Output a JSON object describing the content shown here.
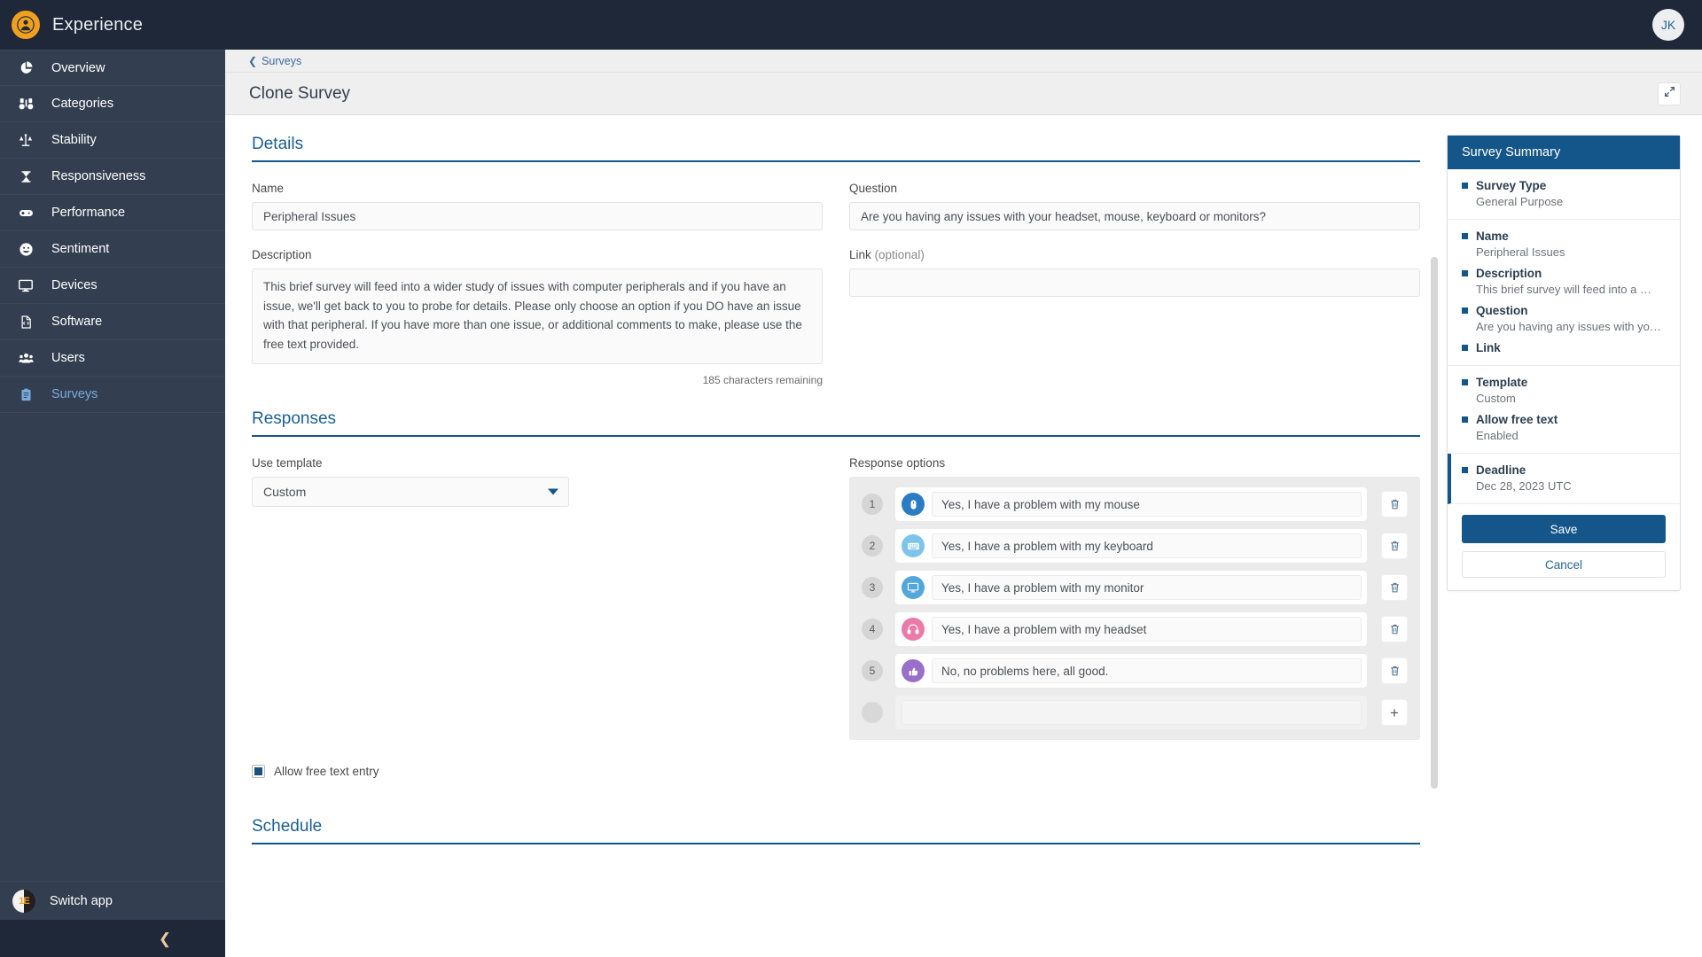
{
  "brand": {
    "title": "Experience"
  },
  "sidebar": {
    "items": [
      {
        "label": "Overview",
        "icon": "pie-chart-icon",
        "active": false
      },
      {
        "label": "Categories",
        "icon": "binoculars-icon",
        "active": false
      },
      {
        "label": "Stability",
        "icon": "scales-icon",
        "active": false
      },
      {
        "label": "Responsiveness",
        "icon": "hourglass-icon",
        "active": false
      },
      {
        "label": "Performance",
        "icon": "gauge-icon",
        "active": false
      },
      {
        "label": "Sentiment",
        "icon": "smiley-icon",
        "active": false
      },
      {
        "label": "Devices",
        "icon": "monitor-icon",
        "active": false
      },
      {
        "label": "Software",
        "icon": "file-code-icon",
        "active": false
      },
      {
        "label": "Users",
        "icon": "users-icon",
        "active": false
      },
      {
        "label": "Surveys",
        "icon": "clipboard-icon",
        "active": true
      }
    ],
    "switch_app": "Switch app",
    "switch_app_logo": "1E",
    "collapse_icon": "chevron-left-icon"
  },
  "topbar": {
    "avatar_initials": "JK"
  },
  "breadcrumb": {
    "label": "Surveys",
    "icon": "chevron-left-icon"
  },
  "page": {
    "title": "Clone Survey",
    "expand_icon": "expand-arrows-icon"
  },
  "details": {
    "section_title": "Details",
    "name_label": "Name",
    "name_value": "Peripheral Issues",
    "name_placeholder": "Name",
    "description_label": "Description",
    "description_value": "This brief survey will feed into a wider study of issues with computer peripherals and if you have an issue, we'll get back to you to probe for details. Please only choose an option if you DO have an issue with that peripheral. If you have more than one issue, or additional comments to make, please use the free text provided.",
    "description_placeholder": "Description",
    "char_count": "185 characters remaining",
    "question_label": "Question",
    "question_value": "Are you having any issues with your headset, mouse, keyboard or monitors?",
    "question_placeholder": "Question",
    "link_label": "Link",
    "link_optional": "(optional)",
    "link_value": "",
    "link_placeholder": ""
  },
  "responses": {
    "section_title": "Responses",
    "template_label": "Use template",
    "template_value": "Custom",
    "template_caret_icon": "chevron-down-icon",
    "options_label": "Response options",
    "options": [
      {
        "num": "1",
        "icon": "mouse-icon",
        "icon_color": "#2b7cc4",
        "text": "Yes, I have a problem with my mouse",
        "action": "trash-icon"
      },
      {
        "num": "2",
        "icon": "keyboard-icon",
        "icon_color": "#7ec4ea",
        "text": "Yes, I have a problem with my keyboard",
        "action": "trash-icon"
      },
      {
        "num": "3",
        "icon": "monitor-icon",
        "icon_color": "#52a6dc",
        "text": "Yes, I have a problem with my monitor",
        "action": "trash-icon"
      },
      {
        "num": "4",
        "icon": "headset-icon",
        "icon_color": "#ea7aa8",
        "text": "Yes, I have a problem with my headset",
        "action": "trash-icon"
      },
      {
        "num": "5",
        "icon": "thumbs-up-icon",
        "icon_color": "#9a6fc9",
        "text": "No, no problems here, all good.",
        "action": "trash-icon"
      }
    ],
    "add_row": {
      "num": "",
      "icon": "",
      "text": "",
      "placeholder": "",
      "action": "plus-icon"
    },
    "free_text_label": "Allow free text entry",
    "free_text_checked": true
  },
  "schedule": {
    "section_title": "Schedule"
  },
  "summary": {
    "title": "Survey Summary",
    "groups": [
      {
        "accent": false,
        "items": [
          {
            "key": "Survey Type",
            "value": "General Purpose"
          }
        ]
      },
      {
        "accent": false,
        "items": [
          {
            "key": "Name",
            "value": "Peripheral Issues"
          },
          {
            "key": "Description",
            "value": "This brief survey will feed into a …"
          },
          {
            "key": "Question",
            "value": "Are you having any issues with yo…"
          },
          {
            "key": "Link",
            "value": ""
          }
        ]
      },
      {
        "accent": false,
        "items": [
          {
            "key": "Template",
            "value": "Custom"
          },
          {
            "key": "Allow free text",
            "value": "Enabled"
          }
        ]
      },
      {
        "accent": true,
        "items": [
          {
            "key": "Deadline",
            "value": "Dec 28, 2023 UTC"
          }
        ]
      }
    ],
    "save_label": "Save",
    "cancel_label": "Cancel"
  },
  "colors": {
    "sidebar_bg": "#333f50",
    "sidebar_dark": "#1f2838",
    "accent_blue": "#14568a",
    "brand_orange": "#f0a020",
    "active_nav": "#7aaadd"
  }
}
